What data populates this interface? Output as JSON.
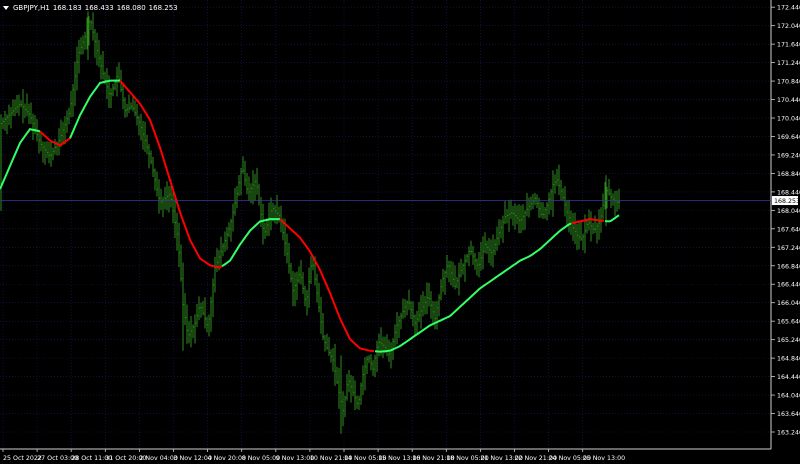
{
  "header": {
    "symbol": "GBPJPY,H1",
    "open": "168.183",
    "high": "168.433",
    "low": "168.080",
    "close": "168.253"
  },
  "colors": {
    "background": "#000000",
    "grid": "#1b1b5a",
    "frame": "#cfcfcf",
    "text": "#ffffff",
    "candle": "#2e8b1e",
    "ma_up": "#33ff66",
    "ma_down": "#ff0000",
    "price_line": "#3a3a9a"
  },
  "chart_data": {
    "type": "line",
    "instrument": "GBPJPY",
    "timeframe": "H1",
    "current_price": 168.253,
    "current_price_label": "168.253",
    "ylim": [
      163.12,
      172.62
    ],
    "y_ticks": [
      "172.440",
      "172.040",
      "171.640",
      "171.240",
      "170.840",
      "170.440",
      "170.040",
      "169.640",
      "169.240",
      "168.840",
      "168.440",
      "168.040",
      "167.640",
      "167.240",
      "166.840",
      "166.440",
      "166.040",
      "165.640",
      "165.240",
      "164.840",
      "164.440",
      "164.040",
      "163.640",
      "163.240"
    ],
    "x_labels": [
      "25 Oct 2022",
      "27 Oct 03:00",
      "28 Oct 11:00",
      "31 Oct 20:00",
      "2 Nov 04:00",
      "3 Nov 12:00",
      "4 Nov 20:00",
      "8 Nov 05:00",
      "9 Nov 13:00",
      "10 Nov 21:00",
      "14 Nov 05:00",
      "15 Nov 13:00",
      "16 Nov 21:00",
      "18 Nov 05:00",
      "21 Nov 13:00",
      "22 Nov 21:00",
      "24 Nov 05:00",
      "25 Nov 13:00"
    ],
    "price_path": [
      [
        0,
        169.9
      ],
      [
        20,
        170.35
      ],
      [
        30,
        170.1
      ],
      [
        40,
        169.5
      ],
      [
        50,
        169.2
      ],
      [
        60,
        169.6
      ],
      [
        70,
        170.2
      ],
      [
        78,
        171.4
      ],
      [
        85,
        171.8
      ],
      [
        90,
        172.2
      ],
      [
        97,
        171.5
      ],
      [
        103,
        171.0
      ],
      [
        110,
        170.5
      ],
      [
        118,
        171.0
      ],
      [
        125,
        170.2
      ],
      [
        132,
        170.3
      ],
      [
        140,
        169.9
      ],
      [
        150,
        169.2
      ],
      [
        160,
        168.2
      ],
      [
        170,
        168.4
      ],
      [
        178,
        167.4
      ],
      [
        183,
        166.0
      ],
      [
        188,
        165.3
      ],
      [
        195,
        165.6
      ],
      [
        200,
        166.0
      ],
      [
        208,
        165.5
      ],
      [
        215,
        166.8
      ],
      [
        222,
        167.2
      ],
      [
        230,
        167.7
      ],
      [
        237,
        168.4
      ],
      [
        242,
        169.0
      ],
      [
        248,
        168.4
      ],
      [
        256,
        168.7
      ],
      [
        264,
        167.5
      ],
      [
        272,
        168.1
      ],
      [
        280,
        167.9
      ],
      [
        287,
        167.1
      ],
      [
        293,
        166.3
      ],
      [
        300,
        166.7
      ],
      [
        306,
        166.0
      ],
      [
        312,
        167.0
      ],
      [
        318,
        166.1
      ],
      [
        323,
        165.3
      ],
      [
        328,
        165.0
      ],
      [
        333,
        164.8
      ],
      [
        338,
        164.2
      ],
      [
        343,
        163.7
      ],
      [
        348,
        164.4
      ],
      [
        353,
        164.1
      ],
      [
        358,
        163.8
      ],
      [
        362,
        164.4
      ],
      [
        368,
        164.9
      ],
      [
        373,
        164.6
      ],
      [
        378,
        165.2
      ],
      [
        384,
        165.1
      ],
      [
        390,
        164.9
      ],
      [
        396,
        165.5
      ],
      [
        402,
        165.8
      ],
      [
        408,
        166.1
      ],
      [
        415,
        165.6
      ],
      [
        422,
        165.9
      ],
      [
        428,
        166.2
      ],
      [
        435,
        165.7
      ],
      [
        442,
        166.5
      ],
      [
        448,
        166.9
      ],
      [
        455,
        166.4
      ],
      [
        462,
        166.8
      ],
      [
        470,
        167.2
      ],
      [
        478,
        166.8
      ],
      [
        485,
        167.3
      ],
      [
        492,
        167.1
      ],
      [
        498,
        167.5
      ],
      [
        505,
        167.9
      ],
      [
        512,
        168.0
      ],
      [
        520,
        167.8
      ],
      [
        528,
        168.1
      ],
      [
        535,
        168.3
      ],
      [
        542,
        167.9
      ],
      [
        548,
        168.2
      ],
      [
        553,
        168.6
      ],
      [
        557,
        168.7
      ],
      [
        562,
        168.4
      ],
      [
        567,
        168.0
      ],
      [
        572,
        167.7
      ],
      [
        577,
        167.5
      ],
      [
        582,
        167.4
      ],
      [
        588,
        167.8
      ],
      [
        594,
        167.6
      ],
      [
        600,
        167.8
      ],
      [
        606,
        168.5
      ],
      [
        612,
        168.3
      ],
      [
        618,
        168.2
      ],
      [
        620,
        168.25
      ]
    ],
    "moving_average": [
      [
        0,
        168.5
      ],
      [
        10,
        169.0
      ],
      [
        20,
        169.5
      ],
      [
        30,
        169.8
      ],
      [
        40,
        169.75
      ],
      [
        50,
        169.55
      ],
      [
        60,
        169.45
      ],
      [
        70,
        169.6
      ],
      [
        80,
        170.1
      ],
      [
        90,
        170.5
      ],
      [
        100,
        170.8
      ],
      [
        110,
        170.85
      ],
      [
        120,
        170.85
      ],
      [
        130,
        170.6
      ],
      [
        140,
        170.35
      ],
      [
        150,
        170.0
      ],
      [
        160,
        169.4
      ],
      [
        170,
        168.7
      ],
      [
        180,
        168.0
      ],
      [
        190,
        167.4
      ],
      [
        200,
        167.0
      ],
      [
        210,
        166.85
      ],
      [
        220,
        166.8
      ],
      [
        230,
        166.95
      ],
      [
        240,
        167.3
      ],
      [
        250,
        167.6
      ],
      [
        260,
        167.8
      ],
      [
        270,
        167.85
      ],
      [
        280,
        167.85
      ],
      [
        290,
        167.65
      ],
      [
        300,
        167.45
      ],
      [
        310,
        167.15
      ],
      [
        320,
        166.75
      ],
      [
        330,
        166.25
      ],
      [
        340,
        165.7
      ],
      [
        350,
        165.25
      ],
      [
        360,
        165.05
      ],
      [
        370,
        165.0
      ],
      [
        380,
        164.98
      ],
      [
        390,
        165.0
      ],
      [
        400,
        165.1
      ],
      [
        410,
        165.25
      ],
      [
        420,
        165.4
      ],
      [
        430,
        165.55
      ],
      [
        440,
        165.65
      ],
      [
        450,
        165.75
      ],
      [
        460,
        165.95
      ],
      [
        470,
        166.15
      ],
      [
        480,
        166.35
      ],
      [
        490,
        166.5
      ],
      [
        500,
        166.65
      ],
      [
        510,
        166.8
      ],
      [
        520,
        166.95
      ],
      [
        530,
        167.05
      ],
      [
        540,
        167.2
      ],
      [
        550,
        167.4
      ],
      [
        560,
        167.6
      ],
      [
        570,
        167.75
      ],
      [
        580,
        167.8
      ],
      [
        590,
        167.85
      ],
      [
        600,
        167.82
      ],
      [
        610,
        167.8
      ],
      [
        620,
        167.95
      ]
    ],
    "ma_color_runs": [
      [
        0,
        40,
        "up"
      ],
      [
        40,
        70,
        "down"
      ],
      [
        70,
        120,
        "up"
      ],
      [
        120,
        222,
        "down"
      ],
      [
        222,
        280,
        "up"
      ],
      [
        280,
        375,
        "down"
      ],
      [
        375,
        572,
        "up"
      ],
      [
        572,
        605,
        "down"
      ],
      [
        605,
        620,
        "up"
      ]
    ]
  }
}
